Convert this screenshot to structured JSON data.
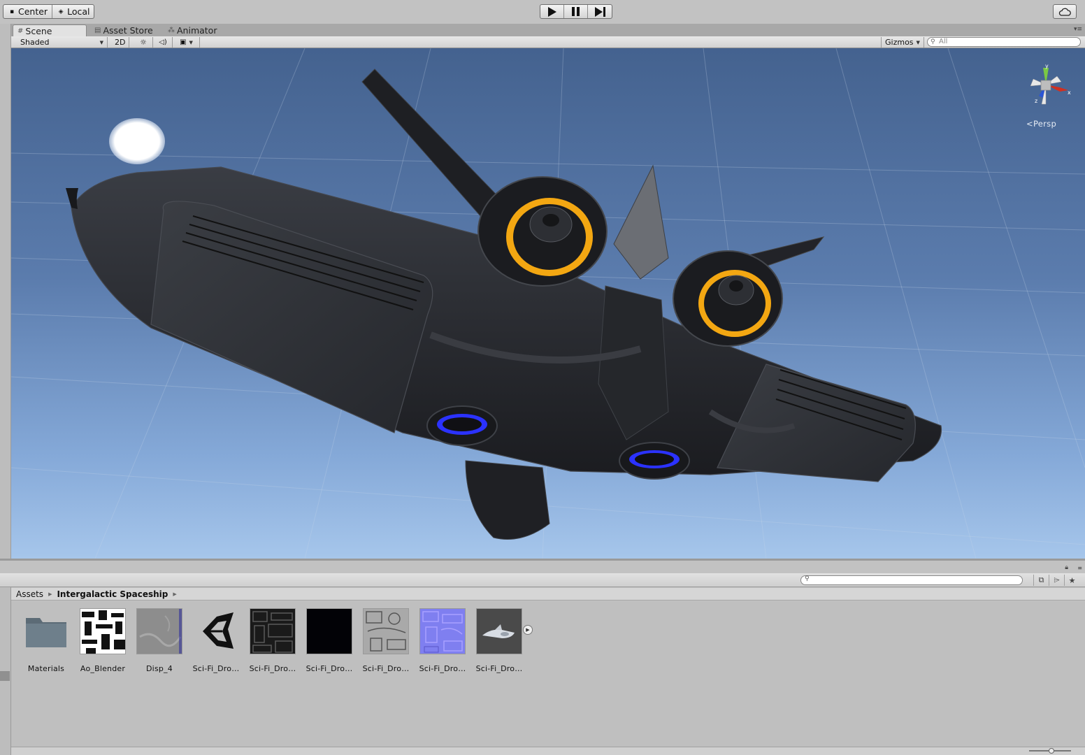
{
  "toolbar": {
    "pivot_label": "Center",
    "handle_label": "Local",
    "play_label": "Play",
    "pause_label": "Pause",
    "step_label": "Step"
  },
  "tabs": [
    {
      "label": "Scene",
      "icon": "grid-icon"
    },
    {
      "label": "Asset Store",
      "icon": "store-icon"
    },
    {
      "label": "Animator",
      "icon": "animator-icon"
    }
  ],
  "scene_toolbar": {
    "shading_mode": "Shaded",
    "mode_2d": "2D",
    "gizmos_label": "Gizmos",
    "search_placeholder": "All"
  },
  "viewport": {
    "projection_label": "Persp",
    "axis_x": "x",
    "axis_y": "y",
    "axis_z": "z"
  },
  "breadcrumb": {
    "root": "Assets",
    "current": "Intergalactic Spaceship"
  },
  "assets": [
    {
      "name": "Materials",
      "kind": "folder"
    },
    {
      "name": "Ao_Blender",
      "kind": "texture-bw"
    },
    {
      "name": "Disp_4",
      "kind": "texture-gray"
    },
    {
      "name": "Sci-Fi_Dro…",
      "kind": "unity-logo"
    },
    {
      "name": "Sci-Fi_Dro…",
      "kind": "texture-dark"
    },
    {
      "name": "Sci-Fi_Dro…",
      "kind": "texture-black"
    },
    {
      "name": "Sci-Fi_Dro…",
      "kind": "texture-gray-detail"
    },
    {
      "name": "Sci-Fi_Dro…",
      "kind": "texture-normal"
    },
    {
      "name": "Sci-Fi_Dro…",
      "kind": "model"
    }
  ],
  "colors": {
    "engine_glow": "#f3a712",
    "thruster_glow": "#2b32ff",
    "sky_top": "#44628f",
    "sky_bottom": "#a6c6eb",
    "ship_body": "#2a2c30"
  }
}
